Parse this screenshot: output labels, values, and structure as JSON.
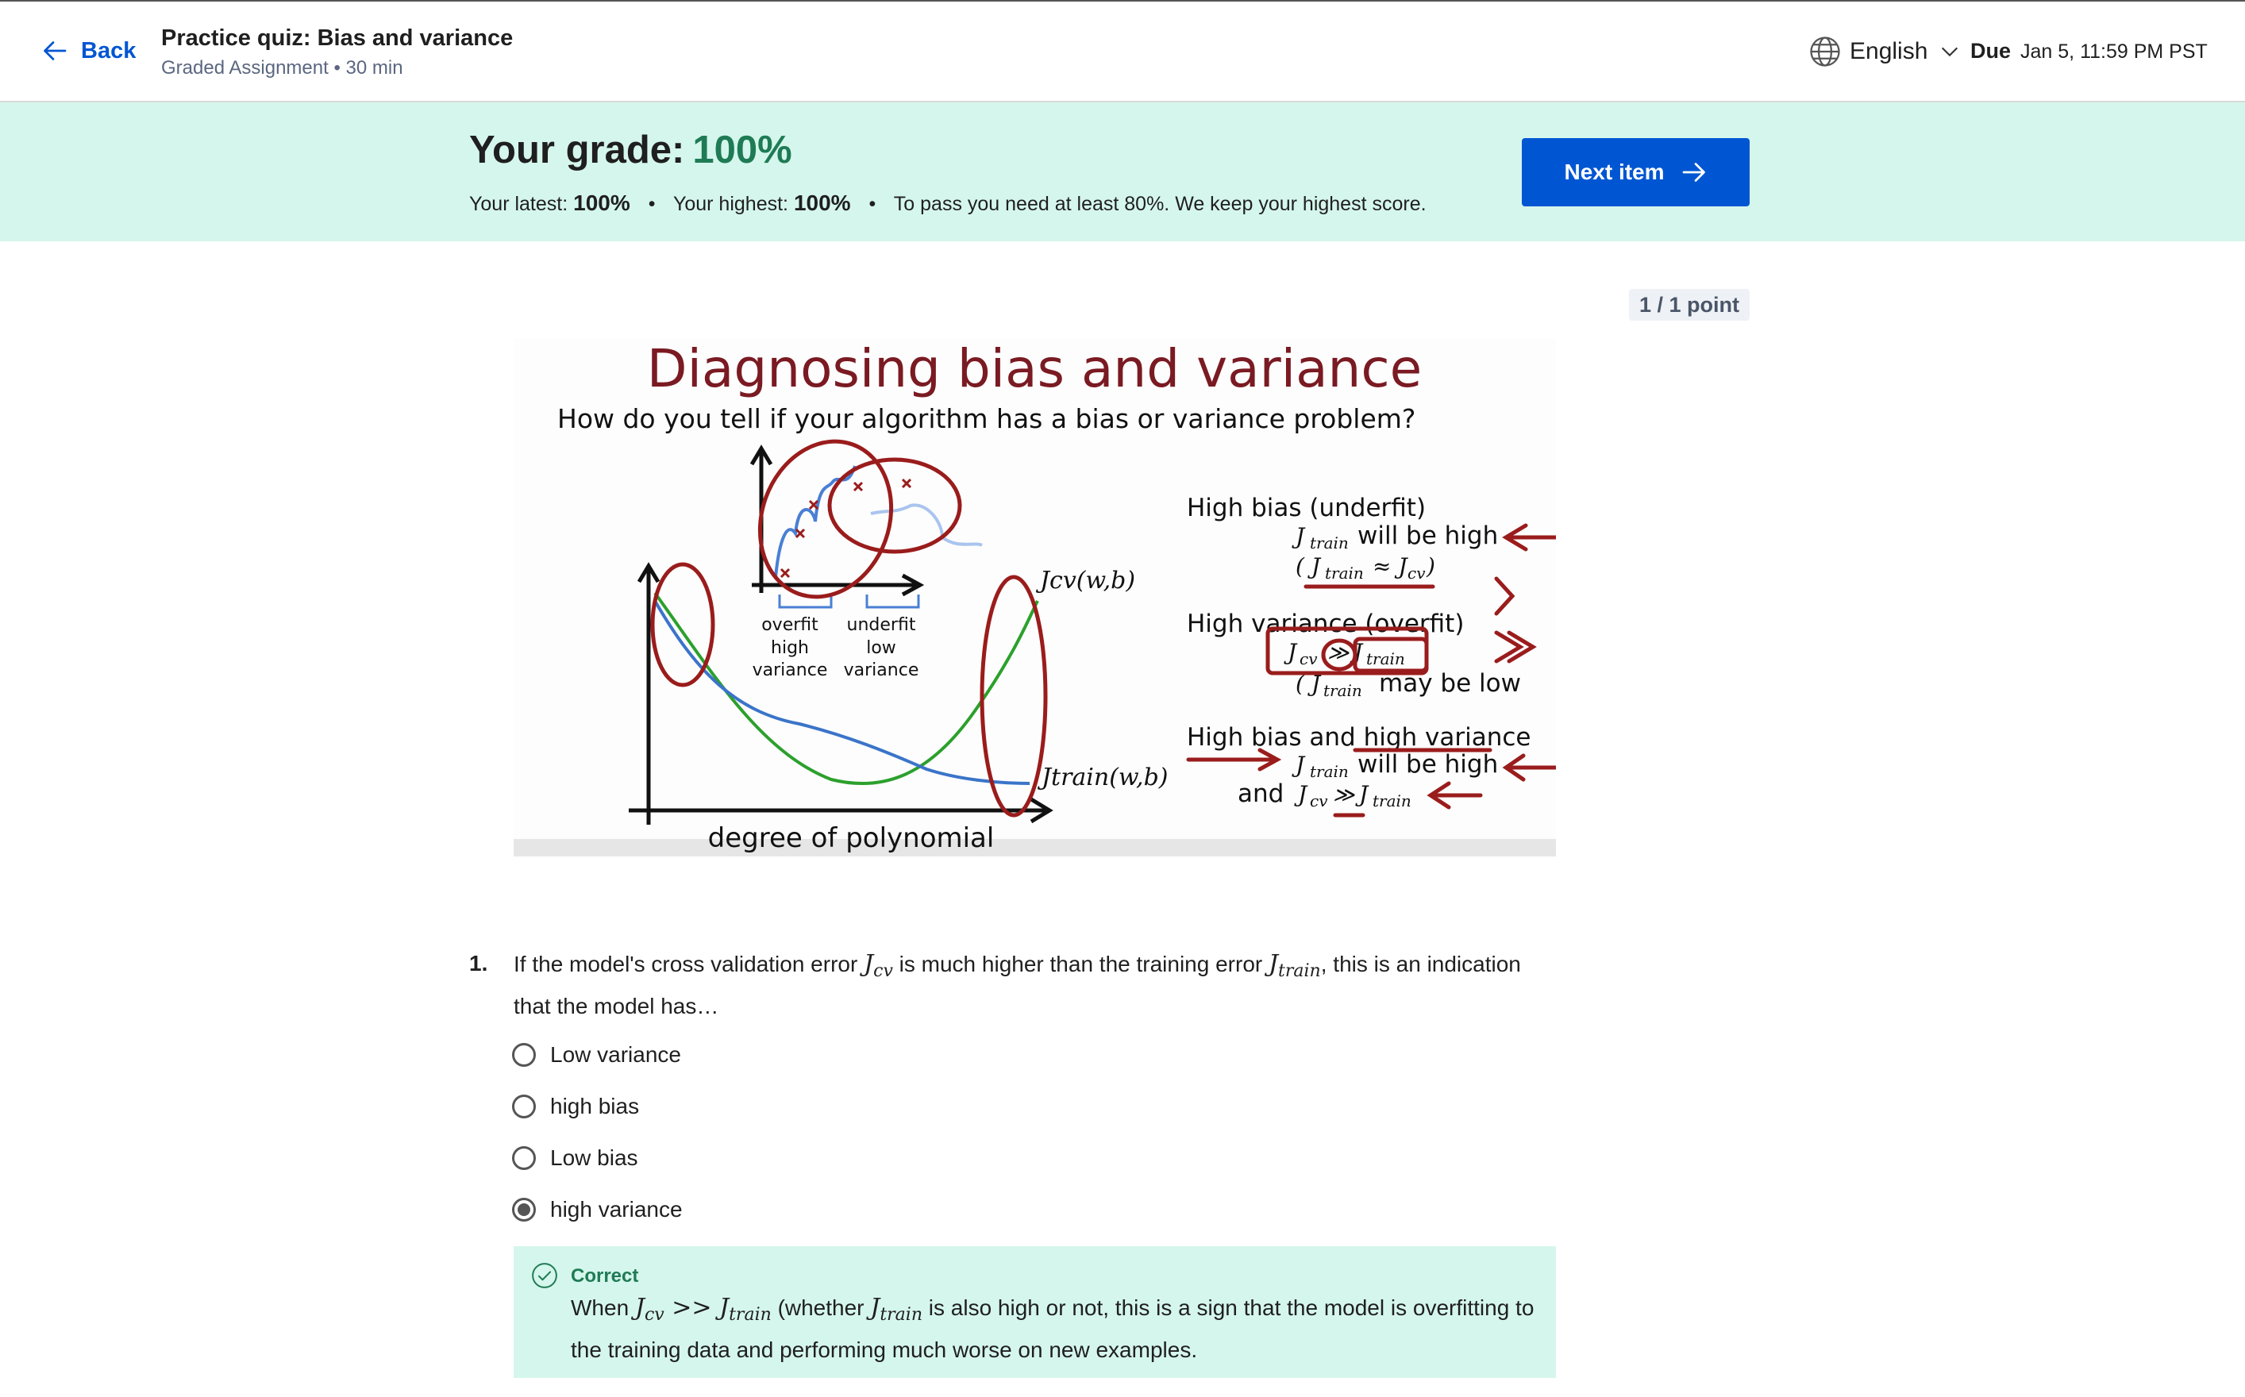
{
  "header": {
    "back_label": "Back",
    "title": "Practice quiz: Bias and variance",
    "subtitle": "Graded Assignment • 30 min",
    "language": "English",
    "due_label": "Due",
    "due_date": "Jan 5, 11:59 PM PST"
  },
  "banner": {
    "grade_label": "Your grade:",
    "grade_value": "100%",
    "latest_label": "Your latest:",
    "latest_value": "100%",
    "highest_label": "Your highest:",
    "highest_value": "100%",
    "pass_text": "To pass you need at least 80%. We keep your highest score.",
    "next_button": "Next item"
  },
  "points": "1 / 1 point",
  "slide": {
    "title": "Diagnosing bias and variance",
    "subtitle": "How do you tell if your algorithm has a bias or variance problem?",
    "x_axis_label": "degree of polynomial",
    "inset_labels": [
      "overfit",
      "high",
      "variance",
      "underfit",
      "low",
      "variance"
    ],
    "jcv_label": "Jcv(w,b)",
    "jtrain_label": "Jtrain(w,b)",
    "right_notes": {
      "high_bias": "High bias (underfit)",
      "high_bias_1": "will be high",
      "high_variance": "High variance (overfit)",
      "high_variance_1": "may be low",
      "both": "High bias and high variance",
      "both_1": "will be high",
      "both_2": "and"
    }
  },
  "question": {
    "number": "1.",
    "text_1": "If the model's cross validation error",
    "text_2": "is much higher than the training error",
    "text_3": ", this is an indication that the model has…",
    "options": [
      {
        "label": "Low variance",
        "selected": false
      },
      {
        "label": "high bias",
        "selected": false
      },
      {
        "label": "Low bias",
        "selected": false
      },
      {
        "label": "high variance",
        "selected": true
      }
    ]
  },
  "feedback": {
    "status": "Correct",
    "text_1": "When",
    "text_2": "(whether",
    "text_3": "is also high or not, this is a sign that the model is overfitting to the training data and performing much worse on new examples."
  },
  "colors": {
    "accent_blue": "#0056d2",
    "success_green": "#1e7b55",
    "banner_bg": "#d5f6ec",
    "slide_title": "#7a1a22",
    "annotation_red": "#9a1c1c"
  }
}
